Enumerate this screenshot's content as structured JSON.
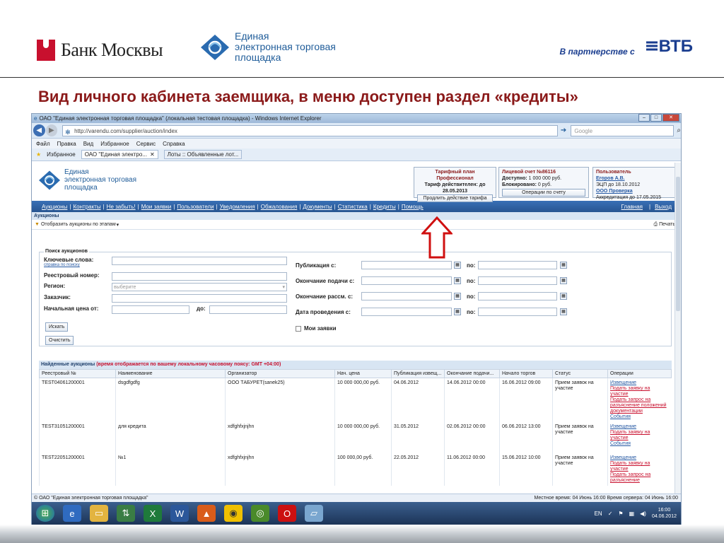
{
  "slide": {
    "bank_name": "Банк Москвы",
    "etp_lines": [
      "Единая",
      "электронная торговая",
      "площадка"
    ],
    "partner_text": "В партнерстве с",
    "vtb": "ВТБ",
    "title": "Вид личного кабинета заемщика, в меню доступен раздел «кредиты»"
  },
  "browser": {
    "window_title": "ОАО \"Единая электронная торговая площадка\" (локальная тестовая площадка) - Windows Internet Explorer",
    "url": "http://varendu.com/supplier/auction/index",
    "search_placeholder": "Google",
    "menu": [
      "Файл",
      "Правка",
      "Вид",
      "Избранное",
      "Сервис",
      "Справка"
    ],
    "favorites_label": "Избранное",
    "tabs": [
      "ОАО \"Единая электро...",
      "Лоты :: Объявленные лот..."
    ],
    "status_left": "© ОАО \"Единая электронная торговая площадка\"",
    "status_right": "Местное время: 04 Июнь 16:00 Время сервера: 04 Июнь 16:00"
  },
  "portal": {
    "logo_lines": [
      "Единая",
      "электронная торговая",
      "площадка"
    ],
    "tariff": {
      "title": "Тарифный план Профессионал",
      "line1": "Тариф действителен: до",
      "date": "28.05.2013",
      "button": "Продлить действие тарифа"
    },
    "account": {
      "title": "Лицевой счет №86116",
      "available_label": "Доступно:",
      "available": "1 000 000 руб.",
      "blocked_label": "Блокировано:",
      "blocked": "0 руб.",
      "button": "Операции по счету"
    },
    "user": {
      "title": "Пользователь",
      "name": "Егоров А.В.",
      "ecp": "ЭЦП до 18.10.2012",
      "org": "ООО Проверка",
      "accr": "Аккредитация до 17.05.2015"
    },
    "nav": [
      "Аукционы",
      "Контракты",
      "Не забыть!",
      "Мои заявки",
      "Пользователи",
      "Уведомления",
      "Обжалования",
      "Документы",
      "Статистика",
      "Кредиты",
      "Помощь"
    ],
    "nav_right": [
      "Главная",
      "Выход"
    ],
    "section": "Аукционы",
    "stage_filter": "Отобразить аукционы по этапам",
    "print": "Печать",
    "search": {
      "legend": "Поиск аукционов",
      "keywords": "Ключевые слова:",
      "help": "справка по поиску",
      "reg_no": "Реестровый номер:",
      "region": "Регион:",
      "region_placeholder": "выберите",
      "customer": "Заказчик:",
      "start_price": "Начальная цена от:",
      "to": "до:",
      "pub": "Публикация с:",
      "sub_end": "Окончание подачи с:",
      "rev_end": "Окончание рассм. с:",
      "hold": "Дата проведения с:",
      "po": "по:",
      "my_bids": "Мои заявки",
      "find": "Искать",
      "clear": "Очистить"
    },
    "results": {
      "title": "Найденные аукционы",
      "tz_note": "(время отображается по вашему локальному часовому поясу: GMT +04:00)",
      "columns": [
        "Реестровый №",
        "Наименование",
        "Организатор",
        "Нач. цена",
        "Публикация извещ...",
        "Окончание подачи...",
        "Начало торгов",
        "Статус",
        "Операции"
      ],
      "rows": [
        {
          "no": "TEST04061200001",
          "name": "dsgdfgdfg",
          "org": "ООО ТАБУРЕТ(sanek25)",
          "price": "10 000 000,00 руб.",
          "pub": "04.06.2012",
          "end": "14.06.2012 00:00",
          "start": "16.06.2012 09:00",
          "status": "Прием заявок на участие",
          "ops": [
            "Извещение",
            "Подать заявку на участие",
            "Подать запрос на разъяснение положений документации",
            "События"
          ]
        },
        {
          "no": "TEST31051200001",
          "name": "для кредита",
          "org": "xdfghfxjnjhn",
          "price": "10 000 000,00 руб.",
          "pub": "31.05.2012",
          "end": "02.06.2012 00:00",
          "start": "06.06.2012 13:00",
          "status": "Прием заявок на участие",
          "ops": [
            "Извещение",
            "Подать заявку на участие",
            "События"
          ]
        },
        {
          "no": "TEST22051200001",
          "name": "№1",
          "org": "xdfghfxjnjhn",
          "price": "100 000,00 руб.",
          "pub": "22.05.2012",
          "end": "11.06.2012 00:00",
          "start": "15.06.2012 10:00",
          "status": "Прием заявок на участие",
          "ops": [
            "Извещение",
            "Подать заявку на участие",
            "Подать запрос на разъяснение"
          ]
        }
      ]
    }
  },
  "taskbar": {
    "lang": "EN",
    "time": "16:00",
    "date": "04.06.2012"
  }
}
